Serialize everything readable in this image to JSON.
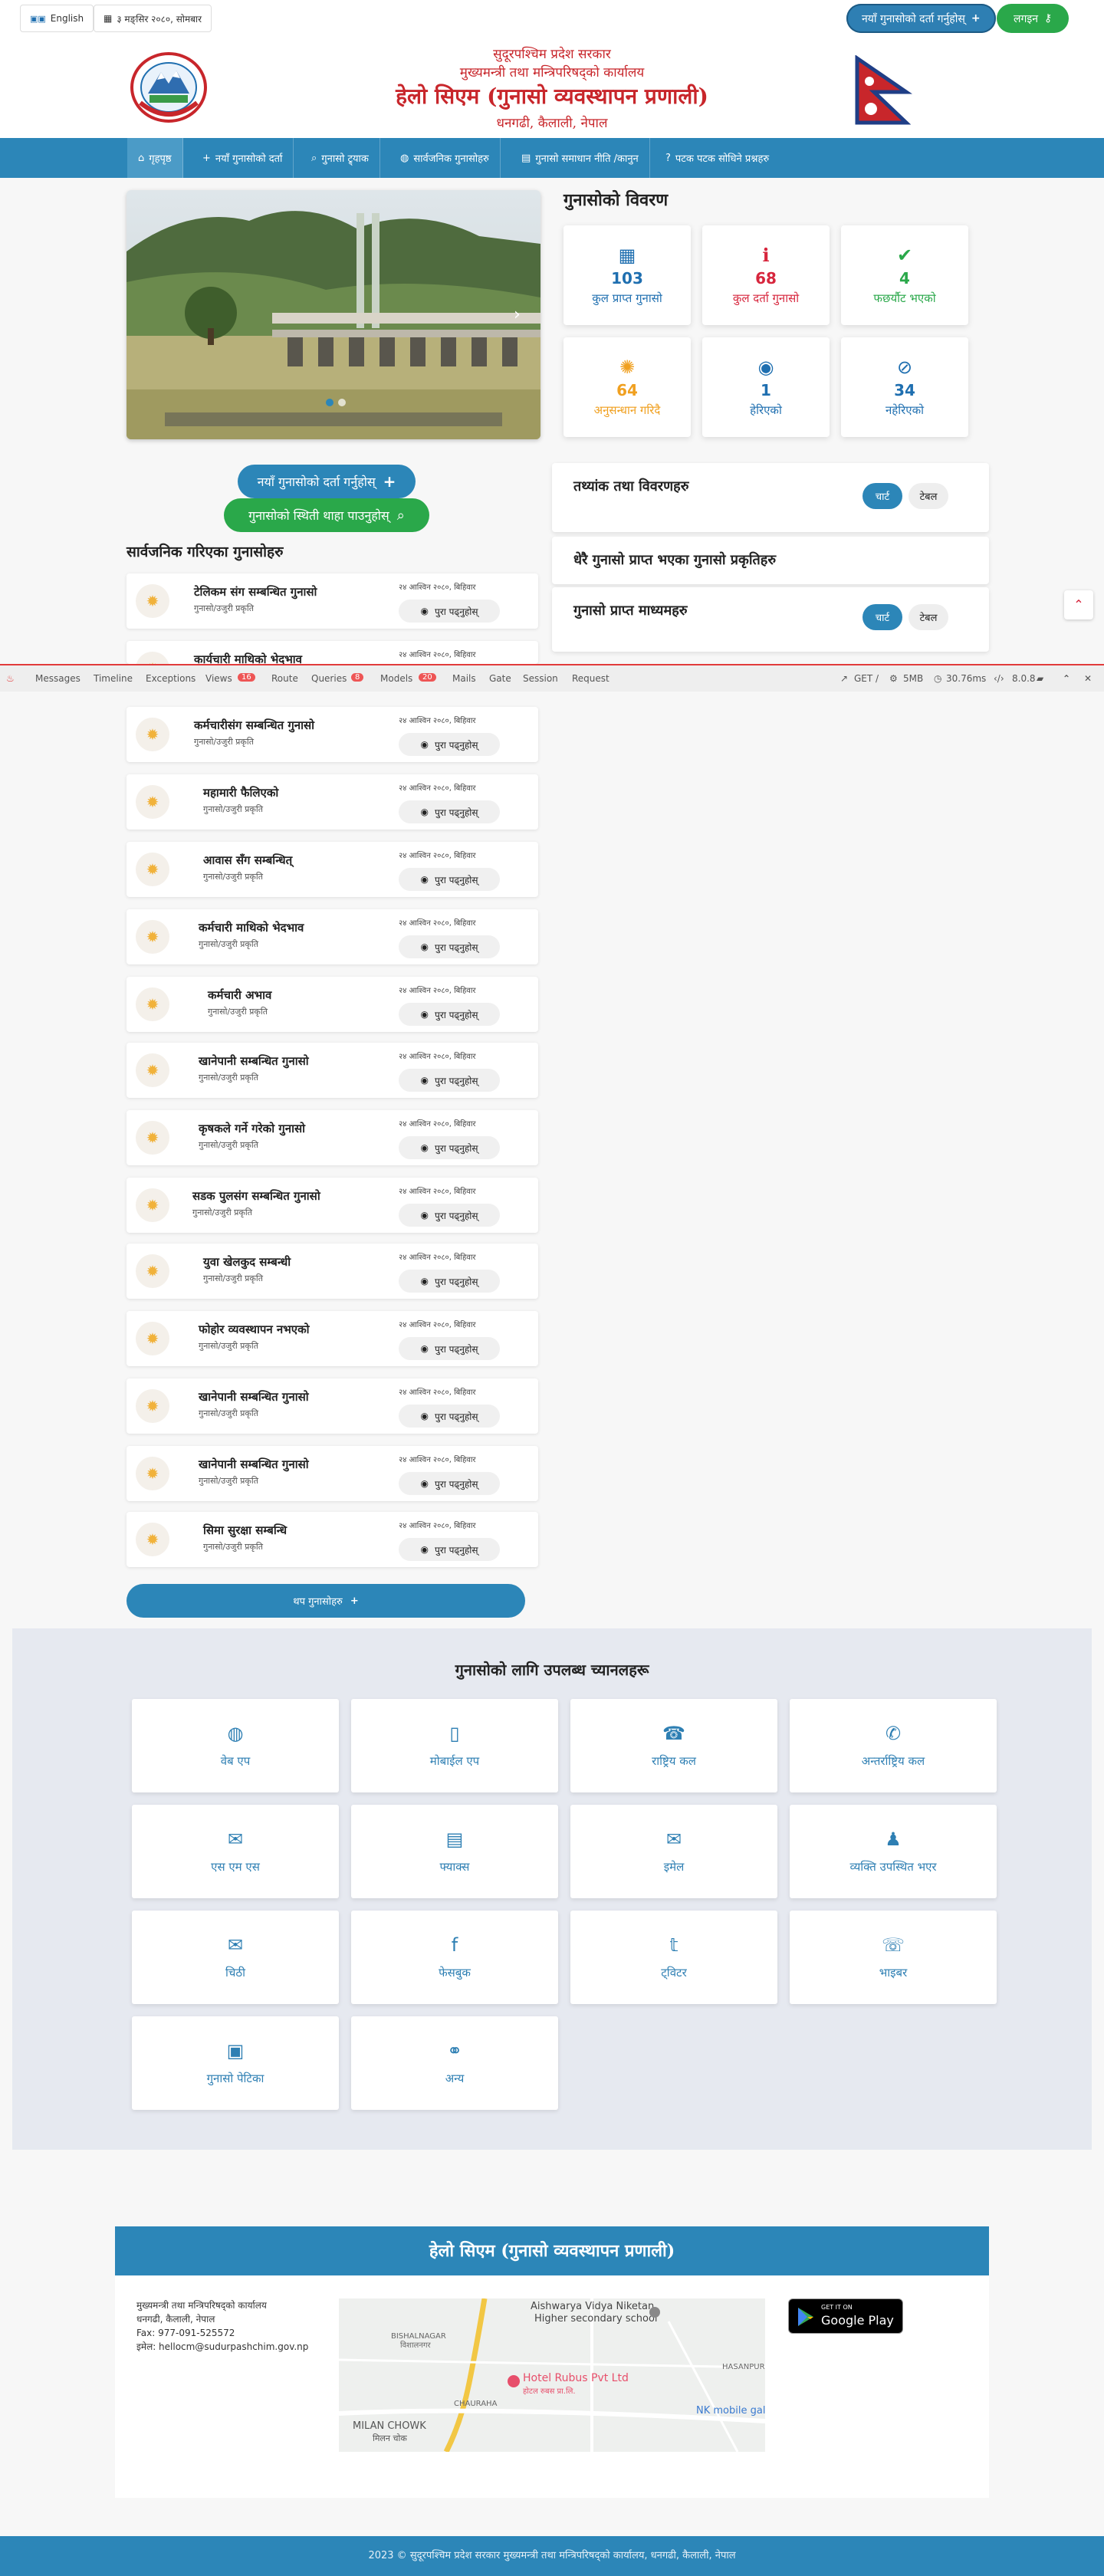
{
  "topbar": {
    "language": "English",
    "date": "३ मङ्सिर २०८०, सोमबार",
    "register_cta": "नयाँ गुनासोको दर्ता गर्नुहोस्",
    "login": "लगइन"
  },
  "header": {
    "line1": "सुदूरपश्चिम प्रदेश सरकार",
    "line2": "मुख्यमन्त्री तथा मन्त्रिपरिषद्को कार्यालय",
    "title": "हेलो सिएम (गुनासो व्यवस्थापन प्रणाली)",
    "address": "धनगढी, कैलाली, नेपाल"
  },
  "nav": {
    "items": [
      {
        "label": "गृहपृष्ठ",
        "icon": "home-icon"
      },
      {
        "label": "नयाँ गुनासोको दर्ता",
        "icon": "plus-icon"
      },
      {
        "label": "गुनासो ट्र्याक",
        "icon": "search-icon"
      },
      {
        "label": "सार्वजनिक गुनासोहरु",
        "icon": "globe-icon"
      },
      {
        "label": "गुनासो समाधान नीति /कानुन",
        "icon": "document-icon"
      },
      {
        "label": "पटक पटक सोधिने प्रश्नहरु",
        "icon": "question-icon"
      }
    ]
  },
  "stats": {
    "title": "गुनासोको विवरण",
    "cards": [
      {
        "value": "103",
        "label": "कुल प्राप्त गुनासो",
        "icon": "calculator-icon",
        "color": "#1f6fb0"
      },
      {
        "value": "68",
        "label": "कुल दर्ता गुनासो",
        "icon": "info-icon",
        "color": "#d7263d"
      },
      {
        "value": "4",
        "label": "फछर्यौट भएको",
        "icon": "check-icon",
        "color": "#2aa84a"
      },
      {
        "value": "64",
        "label": "अनुसन्धान गरिदै",
        "icon": "spinner-icon",
        "color": "#f0a020"
      },
      {
        "value": "1",
        "label": "हेरिएको",
        "icon": "eye-icon",
        "color": "#1f6fb0"
      },
      {
        "value": "34",
        "label": "नहेरिएको",
        "icon": "eye-slash-icon",
        "color": "#1f6fb0"
      }
    ]
  },
  "actions": {
    "register": "नयाँ गुनासोको दर्ता गर्नुहोस्",
    "status": "गुनासोको स्थिती थाहा पाउनुहोस्"
  },
  "panels": [
    {
      "title": "तथ्यांक तथा विवरणहरु",
      "chart_btn": "चार्ट",
      "table_btn": "टेबल"
    },
    {
      "title": "धेरै गुनासो प्राप्त भएका गुनासो प्रकृतिहरु"
    },
    {
      "title": "गुनासो प्राप्त माध्यमहरु",
      "chart_btn": "चार्ट",
      "table_btn": "टेबल"
    }
  ],
  "complaints": {
    "title": "सार्वजनिक गरिएका गुनासोहरु",
    "category": "गुनासो/उजुरी प्रकृति",
    "date": "२४ आश्विन २०८०, बिहिवार",
    "read_more": "पुरा पढ्नुहोस्",
    "items": [
      "टेलिकम संग सम्बन्धित गुनासो",
      "कार्यचारी माथिको भेदभाव",
      "कर्मचारीसंग सम्बन्धित गुनासो",
      "महामारी फैलिएको",
      "आवास सँग सम्बन्धित्",
      "कर्मचारी माथिको भेदभाव",
      "कर्मचारी अभाव",
      "खानेपानी सम्बन्धित गुनासो",
      "कृषकले गर्ने गरेको गुनासो",
      "सडक पुलसंग सम्बन्धित गुनासो",
      "युवा खेलकुद सम्बन्धी",
      "फोहोर व्यवस्थापन नभएको",
      "खानेपानी सम्बन्धित गुनासो",
      "खानेपानी सम्बन्धित गुनासो",
      "सिमा सुरक्षा सम्बन्धि"
    ],
    "more_btn": "थप गुनासोहरु"
  },
  "debugbar": {
    "tabs": [
      "Messages",
      "Timeline",
      "Exceptions",
      "Views",
      "Route",
      "Queries",
      "Models",
      "Mails",
      "Gate",
      "Session",
      "Request"
    ],
    "views_count": "16",
    "queries_count": "8",
    "models_count": "20",
    "method": "GET /",
    "memory": "5MB",
    "time": "30.76ms",
    "version": "8.0.8"
  },
  "channels": {
    "title": "गुनासोको लागि उपलब्ध च्यानलहरू",
    "items": [
      {
        "label": "वेब एप",
        "icon": "globe-icon"
      },
      {
        "label": "मोबाईल एप",
        "icon": "mobile-icon"
      },
      {
        "label": "राष्ट्रिय कल",
        "icon": "phone-square-icon"
      },
      {
        "label": "अन्तर्राष्ट्रिय कल",
        "icon": "phone-icon"
      },
      {
        "label": "एस एम एस",
        "icon": "sms-icon"
      },
      {
        "label": "फ्याक्स",
        "icon": "fax-icon"
      },
      {
        "label": "इमेल",
        "icon": "envelope-icon"
      },
      {
        "label": "व्यक्ति उपस्थित भएर",
        "icon": "person-icon"
      },
      {
        "label": "चिठी",
        "icon": "letter-icon"
      },
      {
        "label": "फेसबुक",
        "icon": "facebook-icon"
      },
      {
        "label": "ट्विटर",
        "icon": "twitter-icon"
      },
      {
        "label": "भाइबर",
        "icon": "viber-icon"
      },
      {
        "label": "गुनासो पेटिका",
        "icon": "box-icon"
      },
      {
        "label": "अन्य",
        "icon": "link-icon"
      }
    ]
  },
  "footer": {
    "title": "हेलो सिएम (गुनासो व्यवस्थापन प्रणाली)",
    "office": "मुख्यमन्त्री तथा मन्त्रिपरिषद्को कार्यालय",
    "address": "धनगढी, कैलाली, नेपाल",
    "fax": "Fax: 977-091-525572",
    "email": "इमेल: hellocm@sudurpashchim.gov.np",
    "map_labels": [
      "Aishwarya Vidya Niketan",
      "Higher secondary school",
      "BISHALNAGAR",
      "विशालनगर",
      "Hotel Rubus Pvt Ltd",
      "होटल रुबस प्रा.लि.",
      "CHAURAHA",
      "MILAN CHOWK",
      "मिलन चोक",
      "HASANPUR",
      "NK mobile gall"
    ],
    "play_small": "GET IT ON",
    "play_big": "Google Play",
    "copyright": "2023 © सुदूरपश्चिम प्रदेश सरकार मुख्यमन्त्री तथा मन्त्रिपरिषद्को कार्यालय, धनगढी, कैलाली, नेपाल"
  }
}
